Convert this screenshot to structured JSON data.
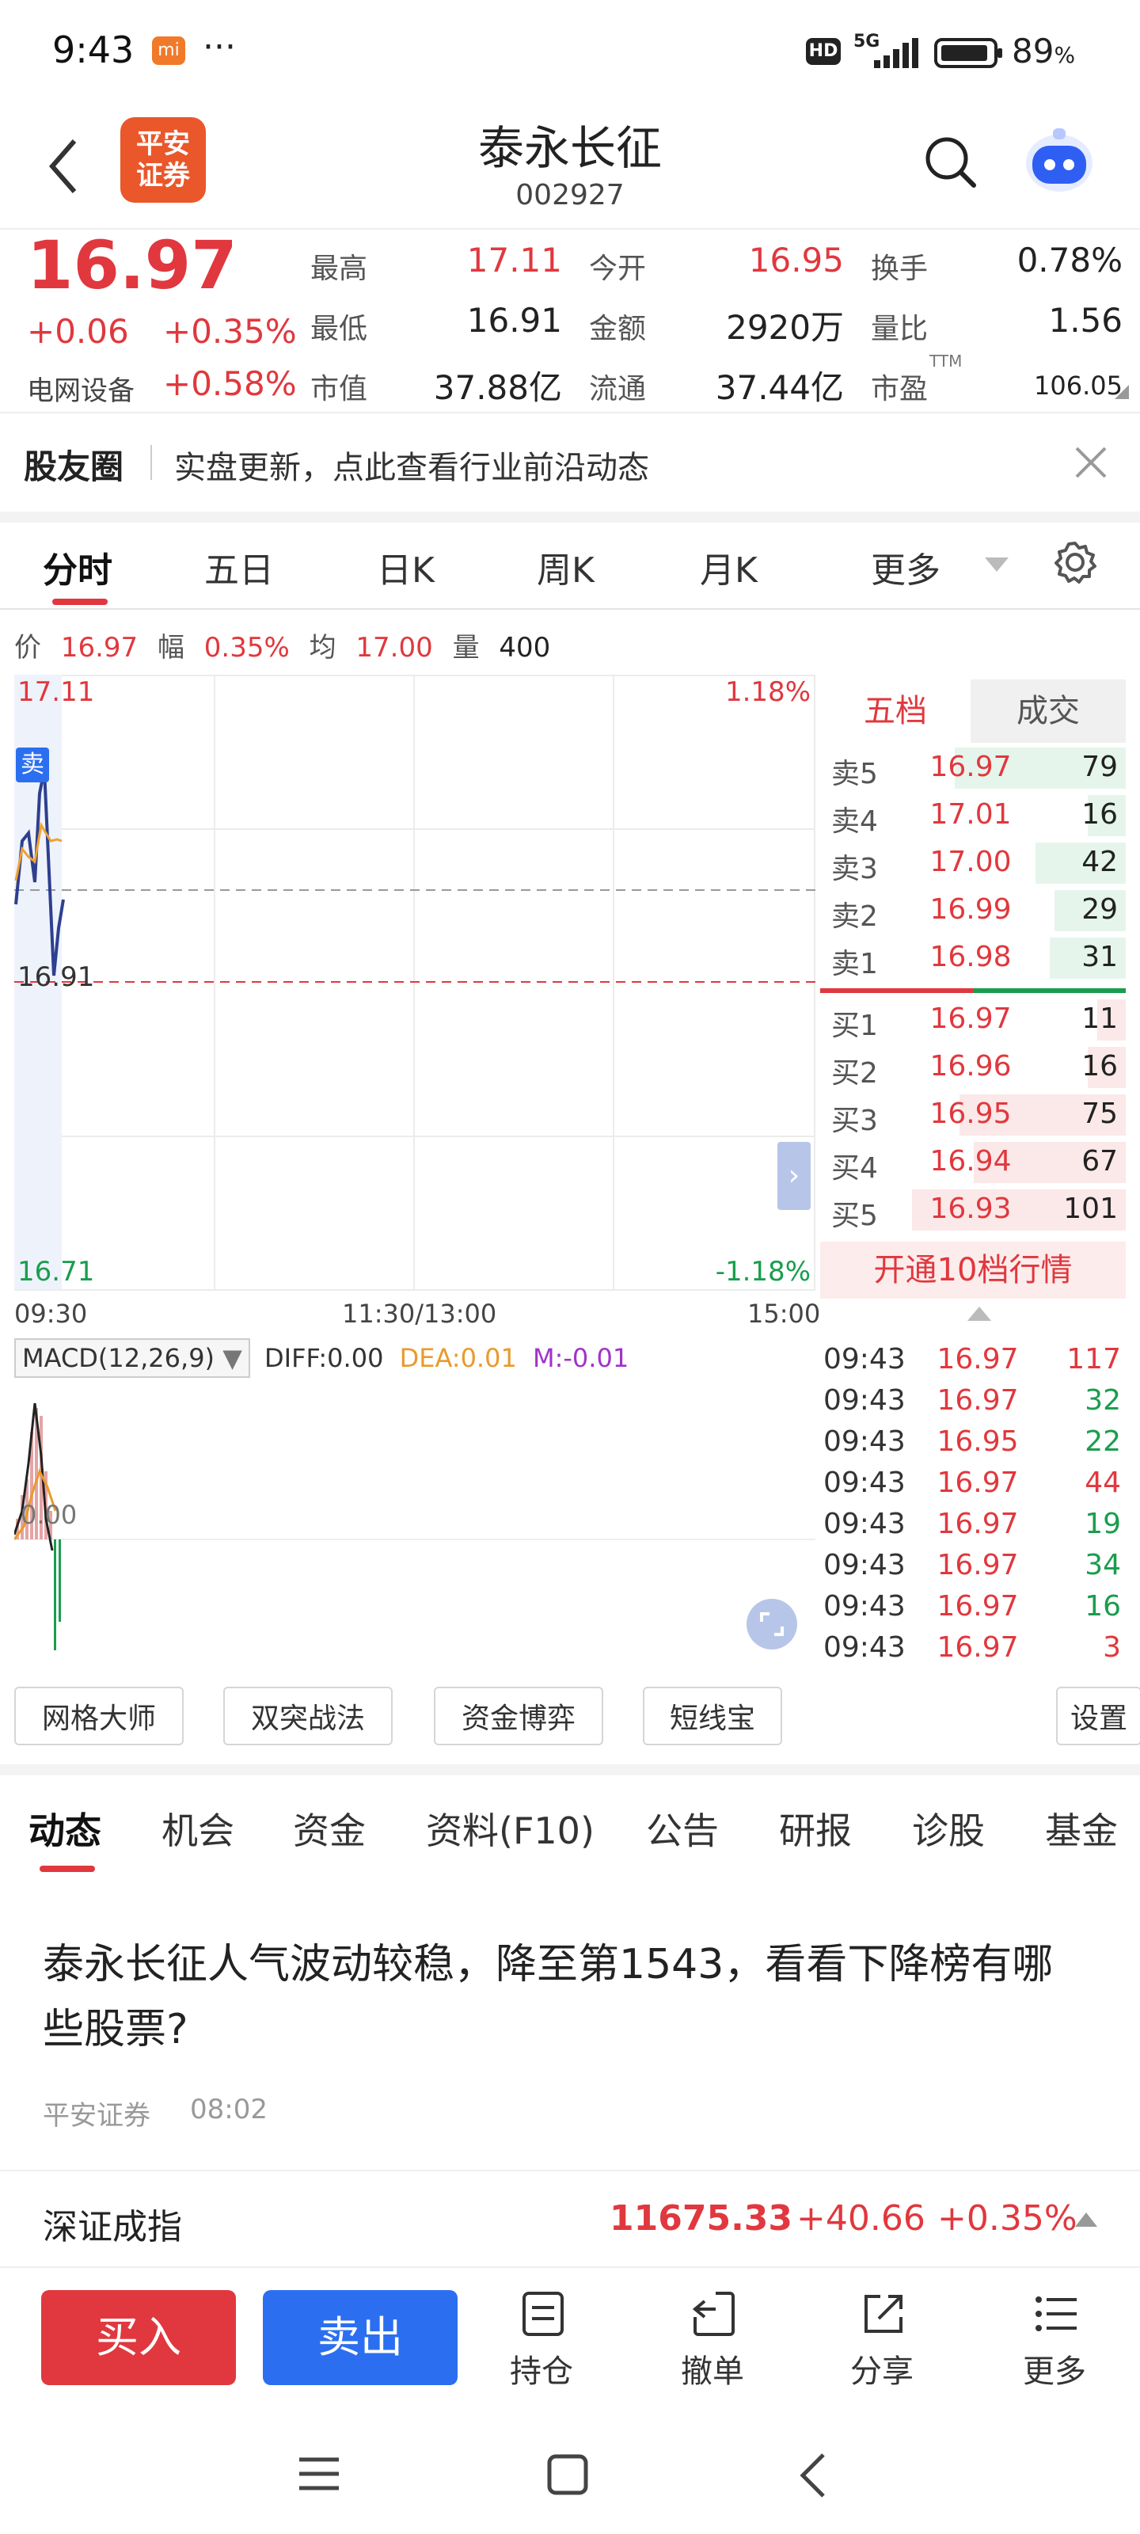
{
  "status_bar": {
    "time": "9:43",
    "dots": "···",
    "app_badge": "mi",
    "hd": "HD",
    "network": "5G",
    "battery": "89",
    "battery_unit": "%"
  },
  "header": {
    "broker_logo": "平安\n证券",
    "stock_name": "泰永长征",
    "stock_code": "002927"
  },
  "quote": {
    "price": "16.97",
    "change": "+0.06",
    "change_pct": "+0.35%",
    "sector": "电网设备",
    "sector_change": "+0.58%",
    "high_label": "最高",
    "high": "17.11",
    "open_label": "今开",
    "open": "16.95",
    "turnover_label": "换手",
    "turnover": "0.78%",
    "low_label": "最低",
    "low": "16.91",
    "amount_label": "金额",
    "amount": "2920万",
    "vol_ratio_label": "量比",
    "vol_ratio": "1.56",
    "mcap_label": "市值",
    "mcap": "37.88亿",
    "float_label": "流通",
    "float": "37.44亿",
    "pe_label": "市盈",
    "pe_sup": "TTM",
    "pe": "106.05"
  },
  "banner": {
    "title": "股友圈",
    "text": "实盘更新，点此查看行业前沿动态"
  },
  "chart_tabs": [
    "分时",
    "五日",
    "日K",
    "周K",
    "月K",
    "更多"
  ],
  "price_line": {
    "price_label": "价",
    "price": "16.97",
    "amp_label": "幅",
    "amp": "0.35%",
    "avg_label": "均",
    "avg": "17.00",
    "vol_label": "量",
    "vol": "400"
  },
  "chart": {
    "max_price": "17.11",
    "max_pct": "1.18%",
    "min_price": "16.71",
    "min_pct": "-1.18%",
    "mid_label": "16.91",
    "sell_marker": "卖",
    "time_start": "09:30",
    "time_mid": "11:30/13:00",
    "time_end": "15:00"
  },
  "orderbook": {
    "tab_levels": "五档",
    "tab_trades": "成交",
    "asks": [
      {
        "label": "卖5",
        "price": "16.97",
        "qty": "79",
        "pct": 0.72
      },
      {
        "label": "卖4",
        "price": "17.01",
        "qty": "16",
        "pct": 0.16
      },
      {
        "label": "卖3",
        "price": "17.00",
        "qty": "42",
        "pct": 0.38
      },
      {
        "label": "卖2",
        "price": "16.99",
        "qty": "29",
        "pct": 0.3
      },
      {
        "label": "卖1",
        "price": "16.98",
        "qty": "31",
        "pct": 0.32
      }
    ],
    "bids": [
      {
        "label": "买1",
        "price": "16.97",
        "qty": "11",
        "pct": 0.12
      },
      {
        "label": "买2",
        "price": "16.96",
        "qty": "16",
        "pct": 0.16
      },
      {
        "label": "买3",
        "price": "16.95",
        "qty": "75",
        "pct": 0.7
      },
      {
        "label": "买4",
        "price": "16.94",
        "qty": "67",
        "pct": 0.64
      },
      {
        "label": "买5",
        "price": "16.93",
        "qty": "101",
        "pct": 0.9
      }
    ],
    "upgrade": "开通10档行情"
  },
  "macd": {
    "label": "MACD(12,26,9)",
    "diff": "DIFF:0.00",
    "dea": "DEA:0.01",
    "m": "M:-0.01",
    "zero": "0.00"
  },
  "ticks": [
    {
      "time": "09:43",
      "price": "16.97",
      "qty": "117",
      "dir": "red"
    },
    {
      "time": "09:43",
      "price": "16.97",
      "qty": "32",
      "dir": "green"
    },
    {
      "time": "09:43",
      "price": "16.95",
      "qty": "22",
      "dir": "green"
    },
    {
      "time": "09:43",
      "price": "16.97",
      "qty": "44",
      "dir": "red"
    },
    {
      "time": "09:43",
      "price": "16.97",
      "qty": "19",
      "dir": "green"
    },
    {
      "time": "09:43",
      "price": "16.97",
      "qty": "34",
      "dir": "green"
    },
    {
      "time": "09:43",
      "price": "16.97",
      "qty": "16",
      "dir": "green"
    },
    {
      "time": "09:43",
      "price": "16.97",
      "qty": "3",
      "dir": "red"
    }
  ],
  "tools": [
    "网格大师",
    "双突战法",
    "资金博弈",
    "短线宝",
    "设置"
  ],
  "news_tabs": [
    "动态",
    "机会",
    "资金",
    "资料(F10)",
    "公告",
    "研报",
    "诊股",
    "基金"
  ],
  "news": {
    "headline": "泰永长征人气波动较稳，降至第1543，看看下降榜有哪些股票?",
    "source": "平安证券",
    "time": "08:02"
  },
  "index": {
    "name": "深证成指",
    "value": "11675.33",
    "change": "+40.66",
    "pct": "+0.35%"
  },
  "bottom": {
    "buy": "买入",
    "sell": "卖出",
    "hold": "持仓",
    "cancel": "撤单",
    "share": "分享",
    "more": "更多"
  },
  "colors": {
    "red": "#e0383e",
    "green": "#1a9d4e",
    "blue": "#2b6ff0",
    "brand_orange": "#e9572a"
  }
}
